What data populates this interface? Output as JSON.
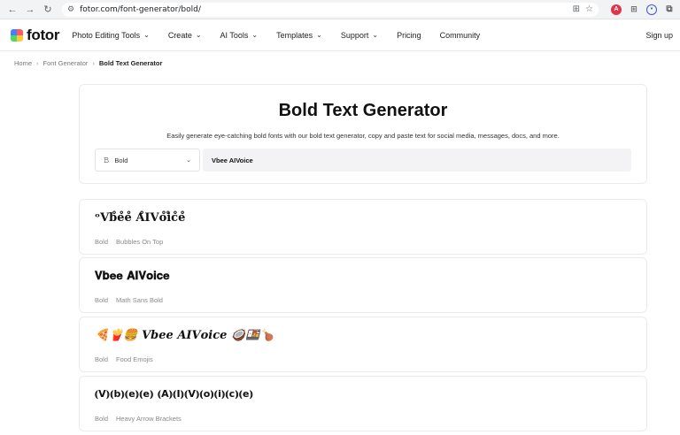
{
  "browser": {
    "url": "fotor.com/font-generator/bold/"
  },
  "header": {
    "logo": "fotor",
    "nav": [
      {
        "label": "Photo Editing Tools",
        "has_dropdown": true
      },
      {
        "label": "Create",
        "has_dropdown": true
      },
      {
        "label": "AI Tools",
        "has_dropdown": true
      },
      {
        "label": "Templates",
        "has_dropdown": true
      },
      {
        "label": "Support",
        "has_dropdown": true
      },
      {
        "label": "Pricing",
        "has_dropdown": false
      },
      {
        "label": "Community",
        "has_dropdown": false
      }
    ],
    "signup": "Sign up"
  },
  "breadcrumb": {
    "home": "Home",
    "parent": "Font Generator",
    "current": "Bold Text Generator"
  },
  "hero": {
    "title": "Bold Text Generator",
    "subtitle": "Easily generate eye-catching bold fonts with our bold text generator, copy and paste text for social media, messages, docs, and more.",
    "style_select": "Bold",
    "input_value": "Vbee AIVoice"
  },
  "results": [
    {
      "text": "ᵒ𝐕𝐛̊𝐞̊𝐞̊ 𝐀̊𝐈𝐕𝐨̊𝐢̊𝐜̊𝐞̊",
      "category": "Bold",
      "style": "Bubbles On Top"
    },
    {
      "text": "𝐕𝐛𝐞𝐞 𝐀𝐈𝐕𝐨𝐢𝐜𝐞",
      "category": "Bold",
      "style": "Math Sans Bold"
    },
    {
      "text": "🍕🍟🍔 𝑽𝒃𝒆𝒆 𝑨𝑰𝑽𝒐𝒊𝒄𝒆 🥥🍱🍗",
      "category": "Bold",
      "style": "Food Emojis"
    },
    {
      "text": "⦅V⦆⦅b⦆⦅e⦆⦅e⦆ ⦅A⦆⦅I⦆⦅V⦆⦅o⦆⦅i⦆⦅c⦆⦅e⦆",
      "category": "Bold",
      "style": "Heavy Arrow Brackets"
    }
  ]
}
